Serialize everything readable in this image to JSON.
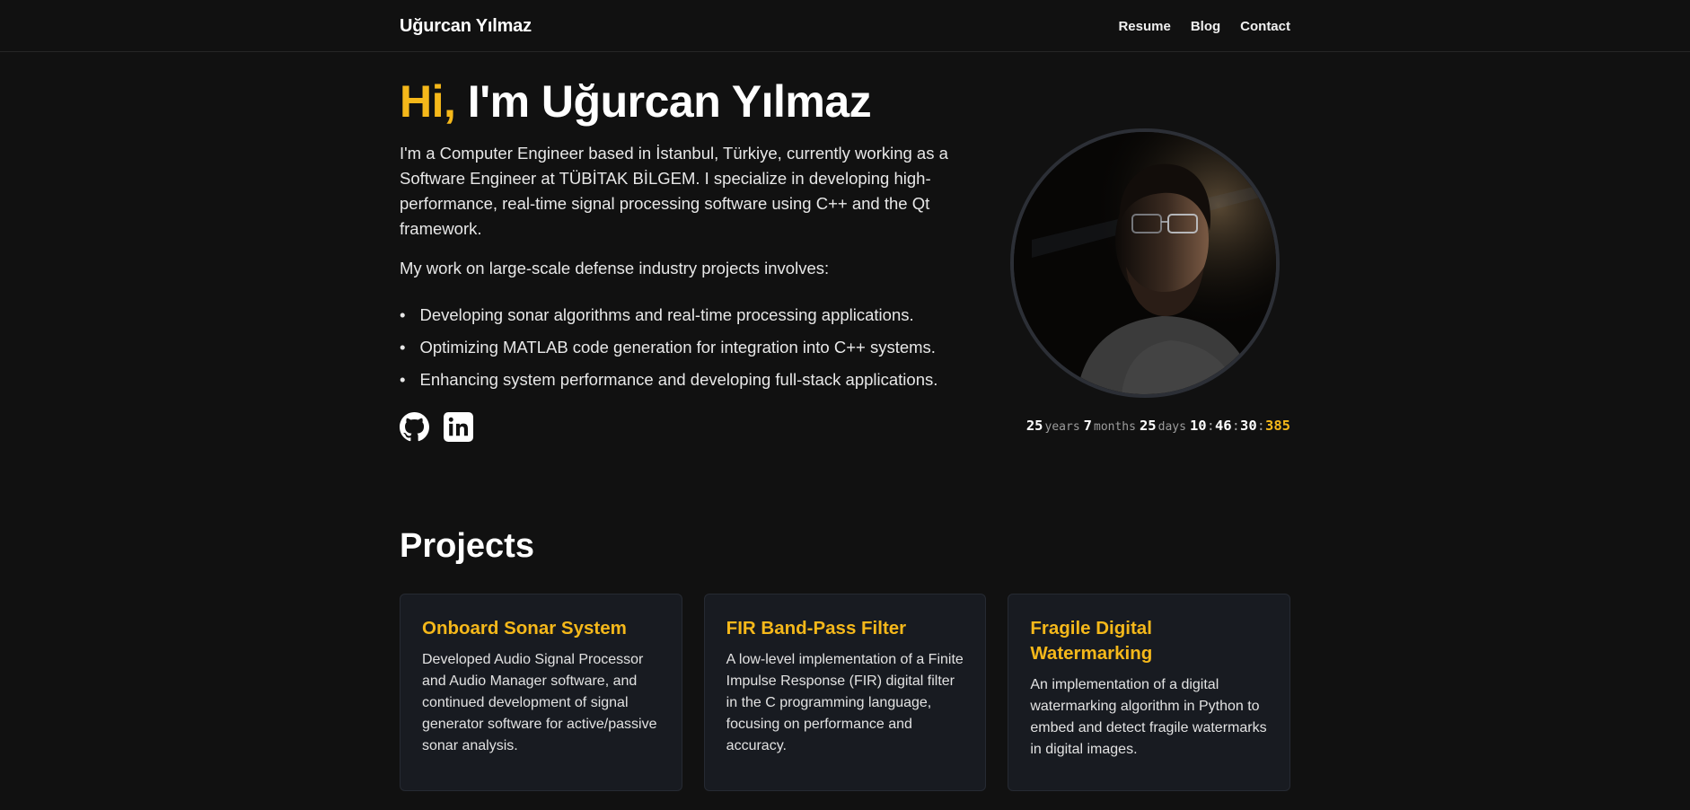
{
  "header": {
    "brand": "Uğurcan Yılmaz",
    "nav": [
      {
        "label": "Resume"
      },
      {
        "label": "Blog"
      },
      {
        "label": "Contact"
      }
    ]
  },
  "hero": {
    "greeting": "Hi,",
    "title_rest": " I'm Uğurcan Yılmaz",
    "intro": "I'm a Computer Engineer based in İstanbul, Türkiye, currently working as a Software Engineer at TÜBİTAK BİLGEM. I specialize in developing high-performance, real-time signal processing software using C++ and the Qt framework.",
    "work_intro": "My work on large-scale defense industry projects involves:",
    "bullets": [
      "Developing sonar algorithms and real-time processing applications.",
      "Optimizing MATLAB code generation for integration into C++ systems.",
      "Enhancing system performance and developing full-stack applications."
    ],
    "socials": [
      {
        "icon": "github-icon"
      },
      {
        "icon": "linkedin-icon"
      }
    ]
  },
  "age": {
    "years": "25",
    "years_unit": "years",
    "months": "7",
    "months_unit": "months",
    "days": "25",
    "days_unit": "days",
    "hours": "10",
    "minutes": "46",
    "seconds": "30",
    "milliseconds": "385"
  },
  "projects": {
    "heading": "Projects",
    "items": [
      {
        "title": "Onboard Sonar System",
        "description": "Developed Audio Signal Processor and Audio Manager software, and continued development of signal generator software for active/passive sonar analysis."
      },
      {
        "title": "FIR Band-Pass Filter",
        "description": "A low-level implementation of a Finite Impulse Response (FIR) digital filter in the C programming language, focusing on performance and accuracy."
      },
      {
        "title": "Fragile Digital Watermarking",
        "description": "An implementation of a digital watermarking algorithm in Python to embed and detect fragile watermarks in digital images."
      }
    ]
  },
  "colors": {
    "accent": "#f5b81a",
    "background": "#111111",
    "card_background": "#181b21"
  }
}
